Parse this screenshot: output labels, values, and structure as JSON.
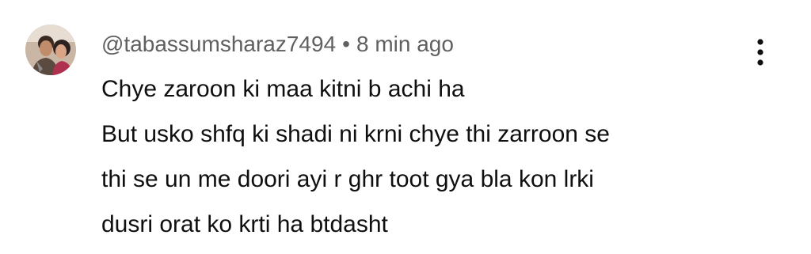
{
  "comment": {
    "author": "@tabassumsharaz7494",
    "separator": "•",
    "time": "8 min ago",
    "lines": [
      "Chye zaroon ki maa kitni b achi ha",
      "But usko shfq ki shadi ni krni chye thi zarroon se",
      "thi se un me doori ayi r ghr toot gya bla kon lrki",
      "dusri orat ko krti ha btdasht"
    ]
  },
  "icons": {
    "avatar": "avatar",
    "menu": "more-vert-icon"
  },
  "colors": {
    "text": "#0f0f0f",
    "meta": "#606060",
    "background": "#ffffff"
  }
}
